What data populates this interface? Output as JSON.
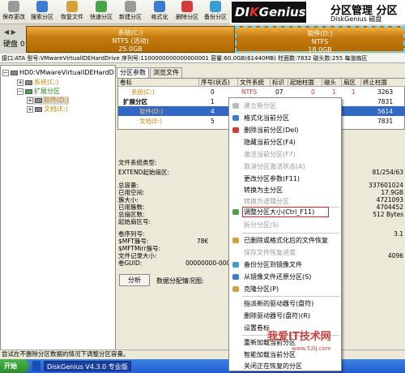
{
  "toolbar": {
    "buttons": [
      {
        "label": "保存更改",
        "color": "#9a9a9a"
      },
      {
        "label": "搜索分区",
        "color": "#3b7bd4"
      },
      {
        "label": "恢复文件",
        "color": "#d4a23b"
      },
      {
        "label": "快速分区",
        "color": "#4aa24a"
      },
      {
        "label": "新建分区",
        "color": "#9a9a9a"
      },
      {
        "label": "格式化",
        "color": "#3b7bd4"
      },
      {
        "label": "删除分区",
        "color": "#d43b3b"
      },
      {
        "label": "备份分区",
        "color": "#3b9bd4"
      }
    ]
  },
  "brand": {
    "logo_a": "DI",
    "logo_b": "K",
    "logo_c": "Genius",
    "title": "分区管理 分区",
    "subtitle": "DiskGenius 磁盘"
  },
  "diskbar": {
    "label": "硬盘 0",
    "partitions": [
      {
        "name": "系统(C:)",
        "fs": "NTFS (活动)",
        "size": "25.0GB"
      },
      {
        "name": "软件(D:)",
        "fs": "NTFS",
        "size": "18.0GB"
      }
    ]
  },
  "infobar": {
    "text": "接口:ATA  型号:VMwareVirtualIDEHardDrive  序列号:1100000000000000001  容量:60.0GB(61440MB)  柱面数:7832  磁头数:255  每道扇区"
  },
  "tree": {
    "items": [
      {
        "text": "HD0:VMwareVirtualIDEHardD",
        "pm": "−"
      },
      {
        "text": "系统(C:)",
        "pm": "+"
      },
      {
        "text": "扩展分区",
        "pm": "−"
      },
      {
        "text": "软件(D:)",
        "pm": "+"
      },
      {
        "text": "文档(E:)",
        "pm": "+"
      }
    ]
  },
  "tabs": [
    {
      "label": "分区参数"
    },
    {
      "label": "浏览文件"
    }
  ],
  "grid": {
    "headers": [
      "卷标",
      "序号(状态)",
      "文件系统",
      "标识",
      "起始柱面",
      "磁头",
      "扇区",
      "终止柱面"
    ],
    "rows": [
      [
        "系统(C:)",
        "0",
        "NTFS",
        "07",
        "0",
        "1",
        "1",
        "3263"
      ],
      [
        "扩展分区",
        "1",
        "EXTEND",
        "0F",
        "3263",
        "254",
        "63",
        "7831"
      ],
      [
        "软件(D:)",
        "4",
        "NTFS",
        "07",
        "3264",
        "",
        "",
        "5614"
      ],
      [
        "文档(E:)",
        "5",
        "NTFS",
        "07",
        "",
        "",
        "",
        "7831"
      ]
    ]
  },
  "details": {
    "left": [
      "文件系统类型:",
      "EXTEND起始扇区:",
      "总容量:",
      "已用空间:",
      "簇大小:",
      "已用簇数:",
      "总扇区数:",
      "起始扇区号:",
      "卷序列号:",
      "$MFT簇号:",
      "$MFTMirr簇号:",
      "文件记录大小:",
      "卷GUID:"
    ],
    "right": [
      "",
      "81/254/63",
      "",
      "337601024",
      "17.9GB",
      "4721093",
      "4704452",
      "512 Bytes",
      "",
      "3.1",
      "",
      "4096",
      ""
    ],
    "mid_a": "78€",
    "mid_b": "00000000-000",
    "analyze_btn": "分析",
    "analyze_label": "数据分配情况图:"
  },
  "menu": {
    "items": [
      {
        "label": "建立新分区",
        "disabled": true,
        "color": "#bbbbbb"
      },
      {
        "label": "格式化当前分区",
        "disabled": false,
        "color": "#3b7bd4"
      },
      {
        "label": "删除当前分区(Del)",
        "disabled": false,
        "color": "#d43b3b"
      },
      {
        "label": "隐藏当前分区(F4)",
        "disabled": false,
        "color": "#888888"
      },
      {
        "label": "激活当前分区(F7)",
        "disabled": true,
        "color": "#bbbbbb"
      },
      {
        "label": "取消分区激活状态(A)",
        "disabled": true,
        "color": "#bbbbbb"
      },
      {
        "label": "更改分区参数(F11)",
        "disabled": false,
        "color": "#888888"
      },
      {
        "label": "转换为主分区",
        "disabled": false,
        "color": "#888888"
      },
      {
        "label": "转换为逻辑分区",
        "disabled": true,
        "color": "#bbbbbb"
      },
      {
        "label": "调整分区大小(Ctrl_F11)",
        "disabled": false,
        "color": "#4aa24a"
      },
      {
        "label": "拆分分区(S)",
        "disabled": true,
        "color": "#bbbbbb"
      },
      {
        "label": "已删除或格式化后的文件恢复",
        "disabled": false,
        "color": "#d4a23b"
      },
      {
        "label": "保存文件恢复进度",
        "disabled": true,
        "color": "#bbbbbb"
      },
      {
        "label": "备份分区到镜像文件",
        "disabled": false,
        "color": "#3b9bd4"
      },
      {
        "label": "从镜像文件还原分区(S)",
        "disabled": false,
        "color": "#3b7bd4"
      },
      {
        "label": "克隆分区(P)",
        "disabled": false,
        "color": "#d4a23b"
      },
      {
        "label": "指派新的驱动器号(盘符)",
        "disabled": false,
        "color": "#888888"
      },
      {
        "label": "删除驱动器号(盘符)(R)",
        "disabled": false,
        "color": "#888888"
      },
      {
        "label": "设置卷标",
        "disabled": false,
        "color": "#888888"
      },
      {
        "label": "重新加载当前分区",
        "disabled": false,
        "color": "#888888"
      },
      {
        "label": "智能加载当前分区",
        "disabled": false,
        "color": "#888888"
      },
      {
        "label": "关闭正在恢复的分区",
        "disabled": false,
        "color": "#888888"
      }
    ]
  },
  "statusbar": {
    "text": "尝试在不删除分区数据的情况下调整分区容量。"
  },
  "taskbar": {
    "start": "开始",
    "app": "DiskGenius V4.3.0 专业版"
  },
  "watermark": {
    "text": "我爱IT技术网",
    "url": "www.52ij.com"
  }
}
